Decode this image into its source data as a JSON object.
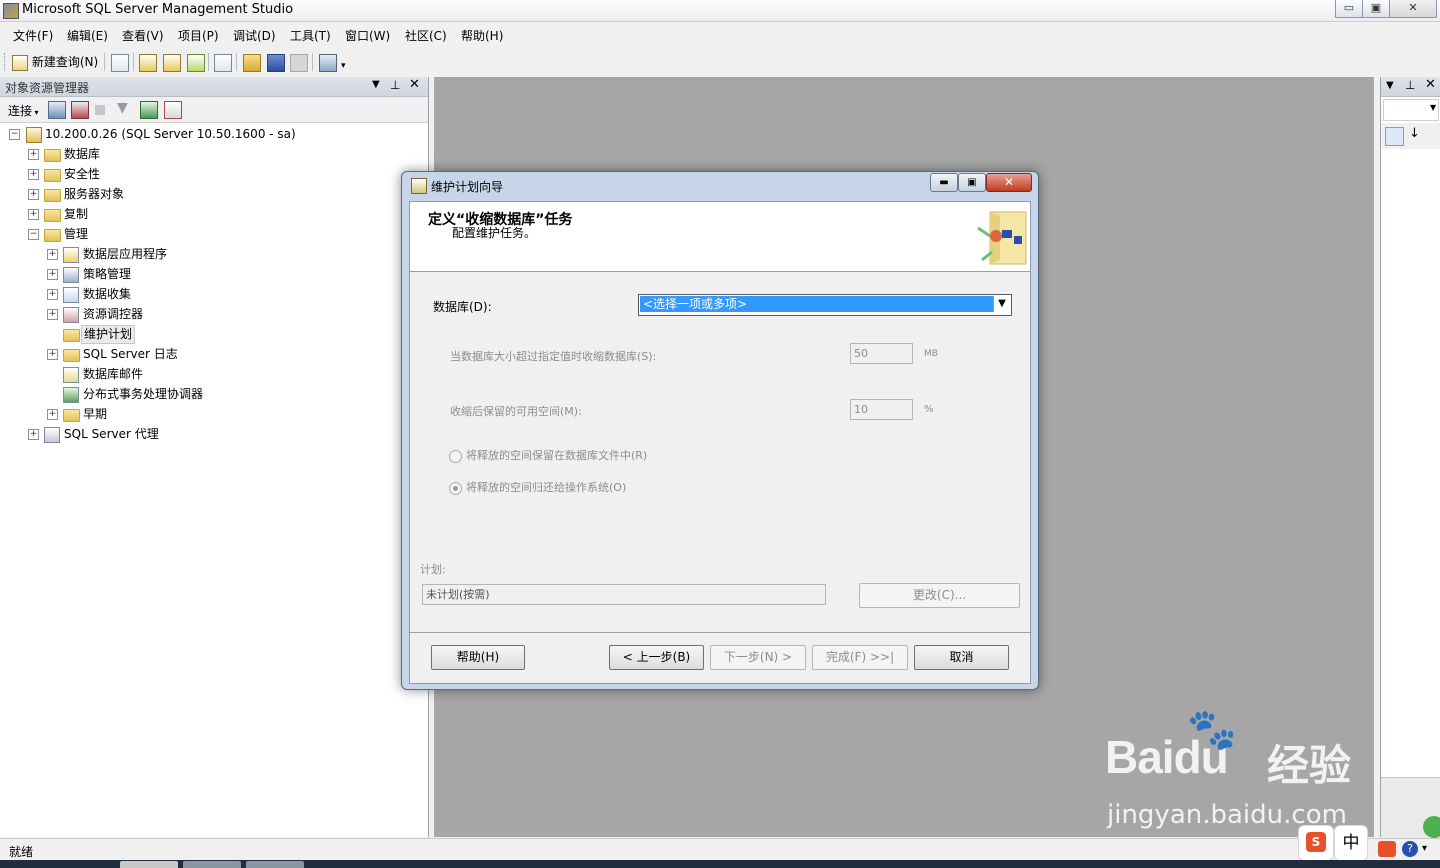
{
  "window": {
    "title": "Microsoft SQL Server Management Studio",
    "controls": [
      "▭",
      "▣",
      "✕"
    ]
  },
  "menu": [
    "文件(F)",
    "编辑(E)",
    "查看(V)",
    "项目(P)",
    "调试(D)",
    "工具(T)",
    "窗口(W)",
    "社区(C)",
    "帮助(H)"
  ],
  "toolbar": {
    "new_query": "新建查询(N)"
  },
  "object_explorer": {
    "title": "对象资源管理器",
    "connect_label": "连接",
    "server": "10.200.0.26 (SQL Server 10.50.1600 - sa)",
    "nodes": {
      "databases": "数据库",
      "security": "安全性",
      "server_objects": "服务器对象",
      "replication": "复制",
      "management": "管理",
      "dac": "数据层应用程序",
      "policy": "策略管理",
      "data_collection": "数据收集",
      "resource_governor": "资源调控器",
      "maintenance_plans": "维护计划",
      "sql_logs": "SQL Server 日志",
      "db_mail": "数据库邮件",
      "dtc": "分布式事务处理协调器",
      "legacy": "早期",
      "agent": "SQL Server 代理"
    }
  },
  "status": {
    "text": "就绪"
  },
  "dialog": {
    "title": "维护计划向导",
    "heading": "定义“收缩数据库”任务",
    "subheading": "配置维护任务。",
    "database_label": "数据库(D):",
    "database_value": "<选择一项或多项>",
    "shrink_when_label": "当数据库大小超过指定值时收缩数据库(S):",
    "shrink_when_value": "50",
    "shrink_when_unit": "MB",
    "free_space_label": "收缩后保留的可用空间(M):",
    "free_space_value": "10",
    "free_space_unit": "%",
    "radio_retain": "将释放的空间保留在数据库文件中(R)",
    "radio_return": "将释放的空间归还给操作系统(O)",
    "schedule_label": "计划:",
    "schedule_value": "未计划(按需)",
    "change_button": "更改(C)...",
    "help_button": "帮助(H)",
    "back_button": "< 上一步(B)",
    "next_button": "下一步(N) >",
    "finish_button": "完成(F) >>|",
    "cancel_button": "取消"
  },
  "watermark": {
    "brand": "Baidu",
    "cn": "经验",
    "url": "jingyan.baidu.com"
  },
  "tray": {
    "ime": "中"
  }
}
